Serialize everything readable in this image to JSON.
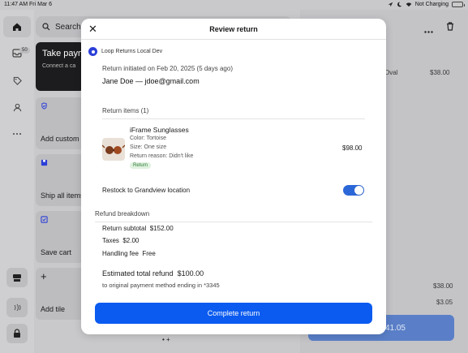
{
  "status_bar": {
    "time": "11:47 AM",
    "date": "Fri Mar 6",
    "battery_label": "Not Charging"
  },
  "rail": {
    "inbox_badge": "50"
  },
  "background": {
    "search_label": "Search",
    "take_payment_title": "Take paym",
    "take_payment_sub": "Connect a ca",
    "tiles": [
      "Add custom s",
      "Ship all items",
      "Save cart",
      "Add tile"
    ],
    "right_item_name": "Oval",
    "right_item_price": "$38.00",
    "summary_values": [
      "$38.00",
      "$3.05"
    ],
    "pay_button": "$41.05",
    "page_dots": "• +"
  },
  "modal": {
    "title": "Review return",
    "store": "Loop Returns Local Dev",
    "initiated": "Return initiated on Feb 20, 2025 (5 days ago)",
    "customer": "Jane Doe — jdoe@gmail.com",
    "return_items_heading": "Return items (1)",
    "item": {
      "name": "iFrame Sunglasses",
      "color": "Color: Tortoise",
      "size": "Size: One size",
      "reason": "Return reason: Didn't like",
      "tag": "Return",
      "price": "$98.00"
    },
    "restock_label": "Restock to Grandview location",
    "restock_on": true,
    "refund_heading": "Refund breakdown",
    "return_subtotal_label": "Return subtotal",
    "return_subtotal_value": "$152.00",
    "taxes_label": "Taxes",
    "taxes_value": "$2.00",
    "handling_label": "Handling fee",
    "handling_value": "Free",
    "estimated_label": "Estimated total refund",
    "estimated_value": "$100.00",
    "payment_note": "to original payment method ending in *3345",
    "cta": "Complete return"
  },
  "colors": {
    "accent": "#0b5bf0",
    "tag_bg": "#dff2df",
    "tag_text": "#2f7a3a"
  }
}
